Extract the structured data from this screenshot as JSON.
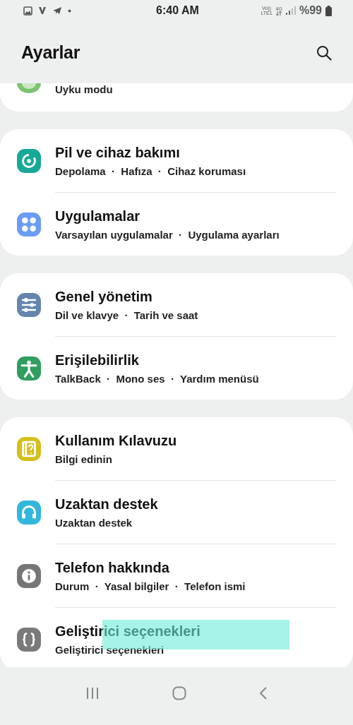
{
  "status_bar": {
    "time": "6:40 AM",
    "network_top": "Vo))",
    "network_bottom": "LTE1",
    "data_type": "4G",
    "battery": "%99"
  },
  "header": {
    "title": "Ayarlar"
  },
  "groups": [
    {
      "items": [
        {
          "kind": "partial",
          "subtitle": "Uyku modu",
          "highlighted": false
        }
      ]
    },
    {
      "items": [
        {
          "title": "Pil ve cihaz bakımı",
          "kind": "care",
          "color": "#17a899",
          "subtitle": "Depolama  ·  Hafıza  ·  Cihaz koruması",
          "highlighted": false
        },
        {
          "title": "Uygulamalar",
          "kind": "apps",
          "color": "#6a9cf2",
          "subtitle": "Varsayılan uygulamalar  ·  Uygulama ayarları",
          "highlighted": false
        }
      ]
    },
    {
      "items": [
        {
          "title": "Genel yönetim",
          "kind": "sliders",
          "color": "#6485ad",
          "subtitle": "Dil ve klavye  ·  Tarih ve saat",
          "highlighted": false
        },
        {
          "title": "Erişilebilirlik",
          "kind": "person",
          "color": "#2f9e5e",
          "subtitle": "TalkBack  ·  Mono ses  ·  Yardım menüsü",
          "highlighted": false
        }
      ]
    },
    {
      "items": [
        {
          "title": "Kullanım Kılavuzu",
          "kind": "book",
          "color": "#d6bf1c",
          "subtitle": "Bilgi edinin",
          "highlighted": false
        },
        {
          "title": "Uzaktan destek",
          "kind": "headset",
          "color": "#33b6dc",
          "subtitle": "Uzaktan destek",
          "highlighted": false
        },
        {
          "title": "Telefon hakkında",
          "kind": "info",
          "color": "#767676",
          "subtitle": "Durum  ·  Yasal bilgiler  ·  Telefon ismi",
          "highlighted": false
        },
        {
          "title": "Geliştirici seçenekleri",
          "kind": "braces",
          "color": "#7a7a7a",
          "subtitle": "Geliştirici seçenekleri",
          "highlighted": true
        }
      ]
    }
  ]
}
